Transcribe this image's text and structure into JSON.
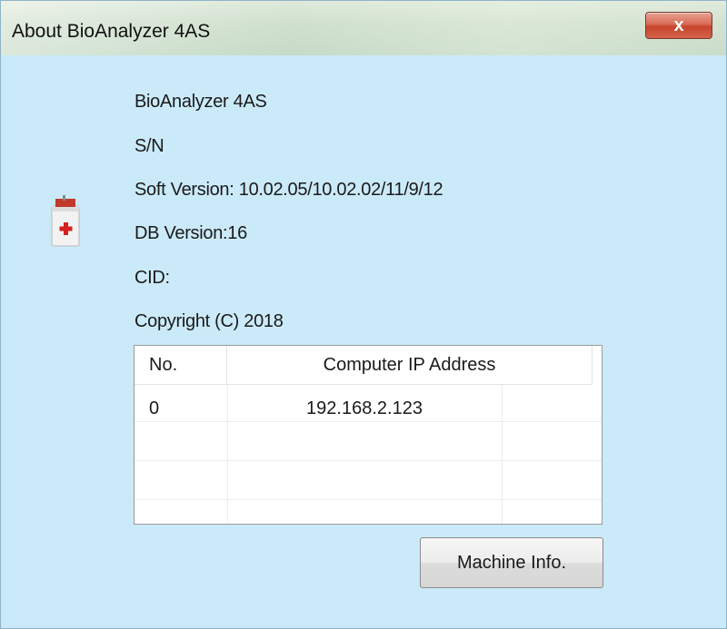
{
  "window": {
    "title": "About BioAnalyzer 4AS",
    "close_label": "x"
  },
  "info": {
    "product": "BioAnalyzer 4AS",
    "sn": "S/N",
    "soft_version": "Soft Version: 10.02.05/10.02.02/11/9/12",
    "db_version": "DB Version:16",
    "cid": "CID:",
    "copyright": "Copyright (C) 2018"
  },
  "table": {
    "headers": [
      "No.",
      "Computer IP Address"
    ],
    "rows": [
      {
        "no": "0",
        "ip": "192.168.2.123"
      }
    ]
  },
  "buttons": {
    "machine_info": "Machine Info."
  },
  "icons": {
    "app": "first-aid-kit-icon",
    "close": "close-icon"
  }
}
